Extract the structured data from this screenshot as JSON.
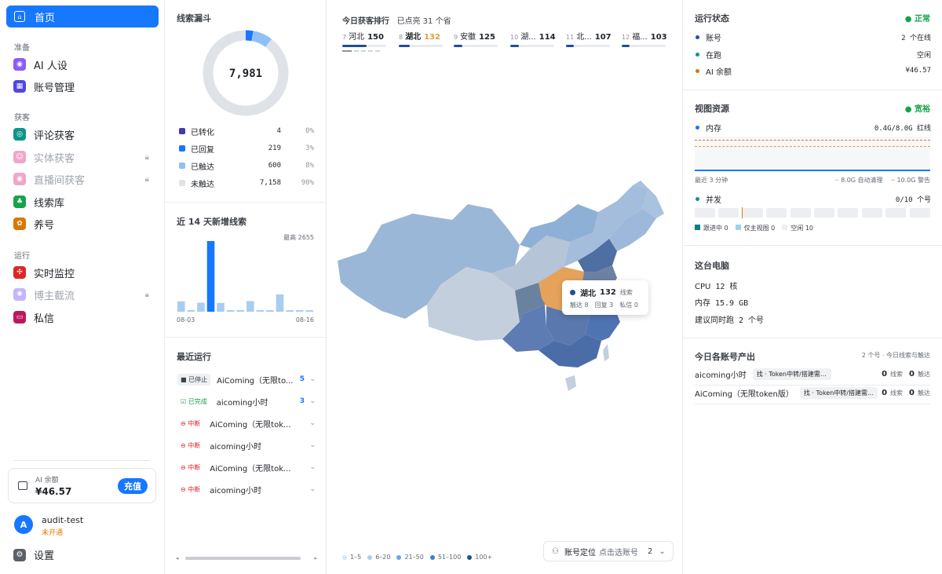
{
  "sidebar": {
    "home": "首页",
    "sections": [
      {
        "label": "准备",
        "items": [
          {
            "label": "AI 人设",
            "color": "#8b5cf6"
          },
          {
            "label": "账号管理",
            "color": "#4f46e5"
          }
        ]
      },
      {
        "label": "获客",
        "items": [
          {
            "label": "评论获客",
            "color": "#0d9488"
          },
          {
            "label": "实体获客",
            "color": "#f0a6c8",
            "disabled": true
          },
          {
            "label": "直播间获客",
            "color": "#f0a6c8",
            "disabled": true
          },
          {
            "label": "线索库",
            "color": "#16a34a"
          },
          {
            "label": "养号",
            "color": "#d97706"
          }
        ]
      },
      {
        "label": "运行",
        "items": [
          {
            "label": "实时监控",
            "color": "#dc2626"
          },
          {
            "label": "博主截流",
            "color": "#c4b5fd",
            "disabled": true
          },
          {
            "label": "私信",
            "color": "#be185d"
          }
        ]
      }
    ],
    "balance_label": "AI 余额",
    "balance_value": "¥46.57",
    "recharge": "充值",
    "user_initial": "A",
    "user_name": "audit-test",
    "user_status": "未开通",
    "settings": "设置"
  },
  "funnel": {
    "title": "线索漏斗",
    "total": "7,981",
    "rows": [
      {
        "label": "已转化",
        "count": "4",
        "pct": "0%",
        "color": "#3f3ca8"
      },
      {
        "label": "已回复",
        "count": "219",
        "pct": "3%",
        "color": "#1677ff"
      },
      {
        "label": "已触达",
        "count": "600",
        "pct": "8%",
        "color": "#8ec0f5"
      },
      {
        "label": "未触达",
        "count": "7,158",
        "pct": "90%",
        "color": "#dfe3e8"
      }
    ]
  },
  "trend": {
    "title": "近 14 天新增线索",
    "max_label": "最高 2655",
    "start": "08-03",
    "end": "08-16",
    "values": [
      390,
      60,
      340,
      2655,
      330,
      30,
      40,
      400,
      40,
      60,
      650,
      40,
      60,
      40
    ]
  },
  "recent": {
    "title": "最近运行",
    "rows": [
      {
        "status": "已停止",
        "name": "AiComing（无限to...",
        "count": "5",
        "kind": "stopped"
      },
      {
        "status": "已完成",
        "name": "aicoming小时",
        "count": "3",
        "kind": "done"
      },
      {
        "status": "中断",
        "name": "AiComing（无限token...",
        "count": "",
        "kind": "broken"
      },
      {
        "status": "中断",
        "name": "aicoming小时",
        "count": "",
        "kind": "broken"
      },
      {
        "status": "中断",
        "name": "AiComing（无限token...",
        "count": "",
        "kind": "broken"
      },
      {
        "status": "中断",
        "name": "aicoming小时",
        "count": "",
        "kind": "broken"
      }
    ]
  },
  "map": {
    "ranking_title": "今日获客排行",
    "ranking_sub": "已点亮 31 个省",
    "ranking": [
      {
        "rank": "7",
        "name": "河北",
        "value": "150",
        "fill": 0.55
      },
      {
        "rank": "8",
        "name": "湖北",
        "value": "132",
        "fill": 0.25,
        "highlight": true
      },
      {
        "rank": "9",
        "name": "安徽",
        "value": "125",
        "fill": 0.2
      },
      {
        "rank": "10",
        "name": "湖...",
        "value": "114",
        "fill": 0.2
      },
      {
        "rank": "11",
        "name": "北...",
        "value": "107",
        "fill": 0.18
      },
      {
        "rank": "12",
        "name": "福...",
        "value": "103",
        "fill": 0.18
      }
    ],
    "tooltip": {
      "name": "湖北",
      "value": "132",
      "unit": "线索",
      "reach": "触达 8",
      "reply": "回复 3",
      "dm": "私信 0"
    },
    "legend": [
      {
        "label": "1–5",
        "color": "#d6e6f7"
      },
      {
        "label": "6–20",
        "color": "#a9cdf0"
      },
      {
        "label": "21–50",
        "color": "#6aa6e3"
      },
      {
        "label": "51–100",
        "color": "#3b7fd0"
      },
      {
        "label": "100+",
        "color": "#1f4e99"
      }
    ],
    "locate_label": "账号定位",
    "locate_hint": "点击选账号",
    "locate_count": "2"
  },
  "status": {
    "title": "运行状态",
    "state": "正常",
    "rows": [
      {
        "label": "账号",
        "value": "2 个在线",
        "color": "#2a4ea8"
      },
      {
        "label": "在跑",
        "value": "空闲",
        "color": "#0d9488"
      },
      {
        "label": "AI 余额",
        "value": "¥46.57",
        "color": "#d97706"
      }
    ]
  },
  "resources": {
    "title": "视图资源",
    "state": "宽裕",
    "mem_label": "内存",
    "mem_value": "0.4G/8.0G 红线",
    "recent": "最近 3 分钟",
    "auto_clean": "8.0G 自动清理",
    "warn": "10.0G 警告",
    "conc_label": "并发",
    "conc_value": "0/10 个号",
    "legend": [
      {
        "label": "跟进中 0",
        "color": "#0d7f8a"
      },
      {
        "label": "仅主视图 0",
        "color": "#9ed3e6"
      },
      {
        "label": "空闲 10",
        "color": "#eceef1"
      }
    ]
  },
  "computer": {
    "title": "这台电脑",
    "rows": [
      {
        "label": "CPU",
        "value": "12 核"
      },
      {
        "label": "内存",
        "value": "15.9 GB"
      },
      {
        "label": "建议同时跑",
        "value": "2 个号"
      }
    ]
  },
  "output": {
    "title": "今日各账号产出",
    "sub": "2 个号 · 今日线索与触达",
    "rows": [
      {
        "name": "aicoming小时",
        "tag": "找 · Token中转/搭建需求人群",
        "leads": "0",
        "leads_unit": "线索",
        "reach": "0",
        "reach_unit": "触达"
      },
      {
        "name": "AiComing（无限token版）",
        "tag": "找 · Token中转/搭建需...",
        "leads": "0",
        "leads_unit": "线索",
        "reach": "0",
        "reach_unit": "触达"
      }
    ]
  }
}
